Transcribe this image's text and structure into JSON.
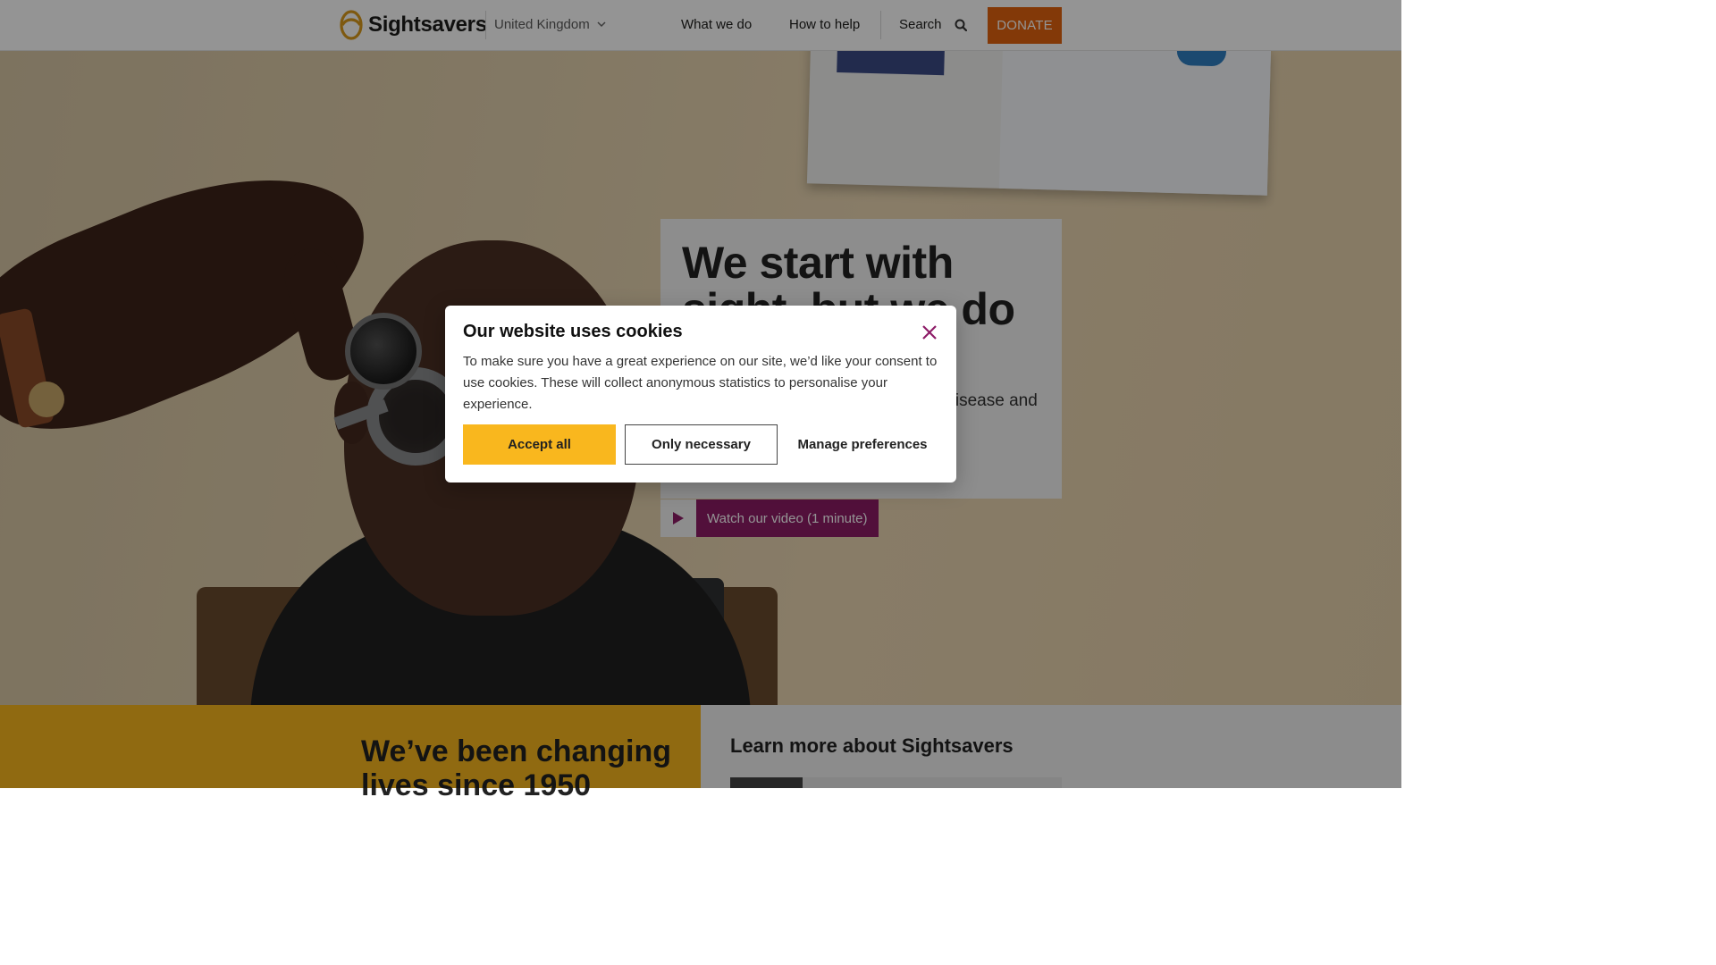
{
  "header": {
    "logo_text": "Sightsavers",
    "country": "United Kingdom",
    "nav": [
      "What we do",
      "How to help"
    ],
    "search_label": "Search",
    "donate_label": "DONATE"
  },
  "hero": {
    "title": "We start with sight, but we do much more",
    "subtitle": "We work to protect sight, eliminate disease and fight for … with your support",
    "video_label": "Watch our video (1 minute)"
  },
  "sections": {
    "history_title": "We’ve been changing lives since 1950",
    "learn_title": "Learn more about Sightsavers"
  },
  "cookie_modal": {
    "title": "Our website uses cookies",
    "body": "To make sure you have a great experience on our site, we’d like your consent to use cookies. These will collect anonymous statistics to personalise your experience.",
    "accept_label": "Accept all",
    "necessary_label": "Only necessary",
    "manage_label": "Manage preferences"
  },
  "colors": {
    "donate": "#e2630e",
    "accent_yellow": "#f9b71e",
    "video_purple": "#8d1c67",
    "close_icon": "#8d1c67"
  },
  "icons": [
    "logo-icon",
    "chevron-down-icon",
    "search-icon",
    "play-icon",
    "close-icon"
  ]
}
